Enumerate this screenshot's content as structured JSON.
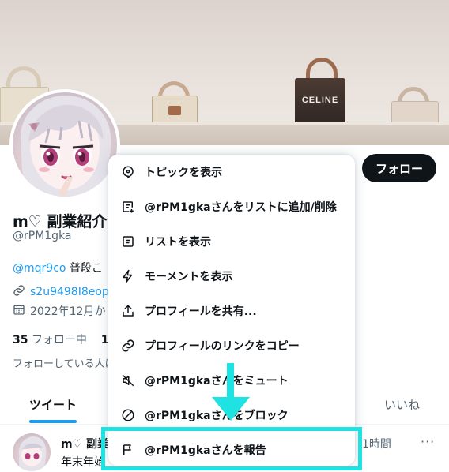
{
  "banner": {
    "brand_text": "CELINE"
  },
  "profile": {
    "display_name": "m♡ 副業紹介",
    "handle": "@rPM1gka",
    "bio_mention": "@mqr9co",
    "bio_text": "普段こ",
    "link": "s2u9498I8eop.l",
    "joined": "2022年12月か",
    "following_count": "35",
    "following_label": "フォロー中",
    "followers_count": "1(",
    "followed_by_text": "フォローしている人は"
  },
  "follow_button": {
    "label": "フォロー"
  },
  "menu": {
    "items": [
      {
        "label": "トピックを表示",
        "icon": "topic-icon"
      },
      {
        "label": "@rPM1gkaさんをリストに追加/削除",
        "icon": "list-add-icon"
      },
      {
        "label": "リストを表示",
        "icon": "list-icon"
      },
      {
        "label": "モーメントを表示",
        "icon": "lightning-icon"
      },
      {
        "label": "プロフィールを共有...",
        "icon": "share-icon"
      },
      {
        "label": "プロフィールのリンクをコピー",
        "icon": "link-icon"
      },
      {
        "label": "@rPM1gkaさんをミュート",
        "icon": "mute-icon"
      },
      {
        "label": "@rPM1gkaさんをブロック",
        "icon": "block-icon"
      },
      {
        "label": "@rPM1gkaさんを報告",
        "icon": "flag-icon"
      }
    ]
  },
  "tabs": {
    "tweets": "ツイート",
    "likes": "いいね"
  },
  "tweet": {
    "name": "m♡ 副業",
    "text": "年末年始",
    "time": "1時間",
    "more": "···"
  },
  "colors": {
    "highlight": "#1fe3e3",
    "accent": "#1d9bf0",
    "button_bg": "#0f1419"
  }
}
